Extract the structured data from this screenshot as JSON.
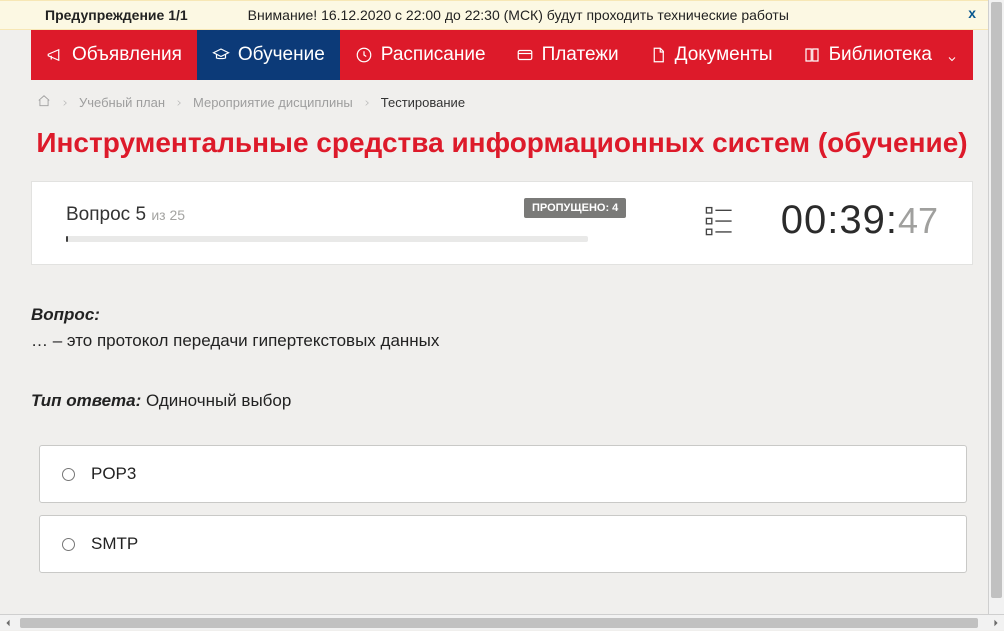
{
  "warning": {
    "label": "Предупреждение 1/1",
    "message": "Внимание! 16.12.2020 с 22:00 до 22:30 (МСК) будут проходить технические работы",
    "close": "x"
  },
  "nav": {
    "items": [
      {
        "label": "Объявления",
        "active": false
      },
      {
        "label": "Обучение",
        "active": true
      },
      {
        "label": "Расписание",
        "active": false
      },
      {
        "label": "Платежи",
        "active": false
      },
      {
        "label": "Документы",
        "active": false
      },
      {
        "label": "Библиотека",
        "active": false,
        "has_dropdown": true
      }
    ]
  },
  "breadcrumbs": {
    "items": [
      "Учебный план",
      "Мероприятие дисциплины",
      "Тестирование"
    ]
  },
  "page": {
    "title": "Инструментальные средства информационных систем (обучение)"
  },
  "status": {
    "question_word": "Вопрос",
    "question_num": "5",
    "of_word": "из",
    "total": "25",
    "skipped_label": "ПРОПУЩЕНО: 4",
    "timer_main": "00:39:",
    "timer_secs": "47"
  },
  "question": {
    "label": "Вопрос:",
    "text": "… – это протокол передачи гипертекстовых данных",
    "answer_type_label": "Тип ответа:",
    "answer_type_value": "Одиночный выбор",
    "options": [
      "POP3",
      "SMTP"
    ]
  }
}
